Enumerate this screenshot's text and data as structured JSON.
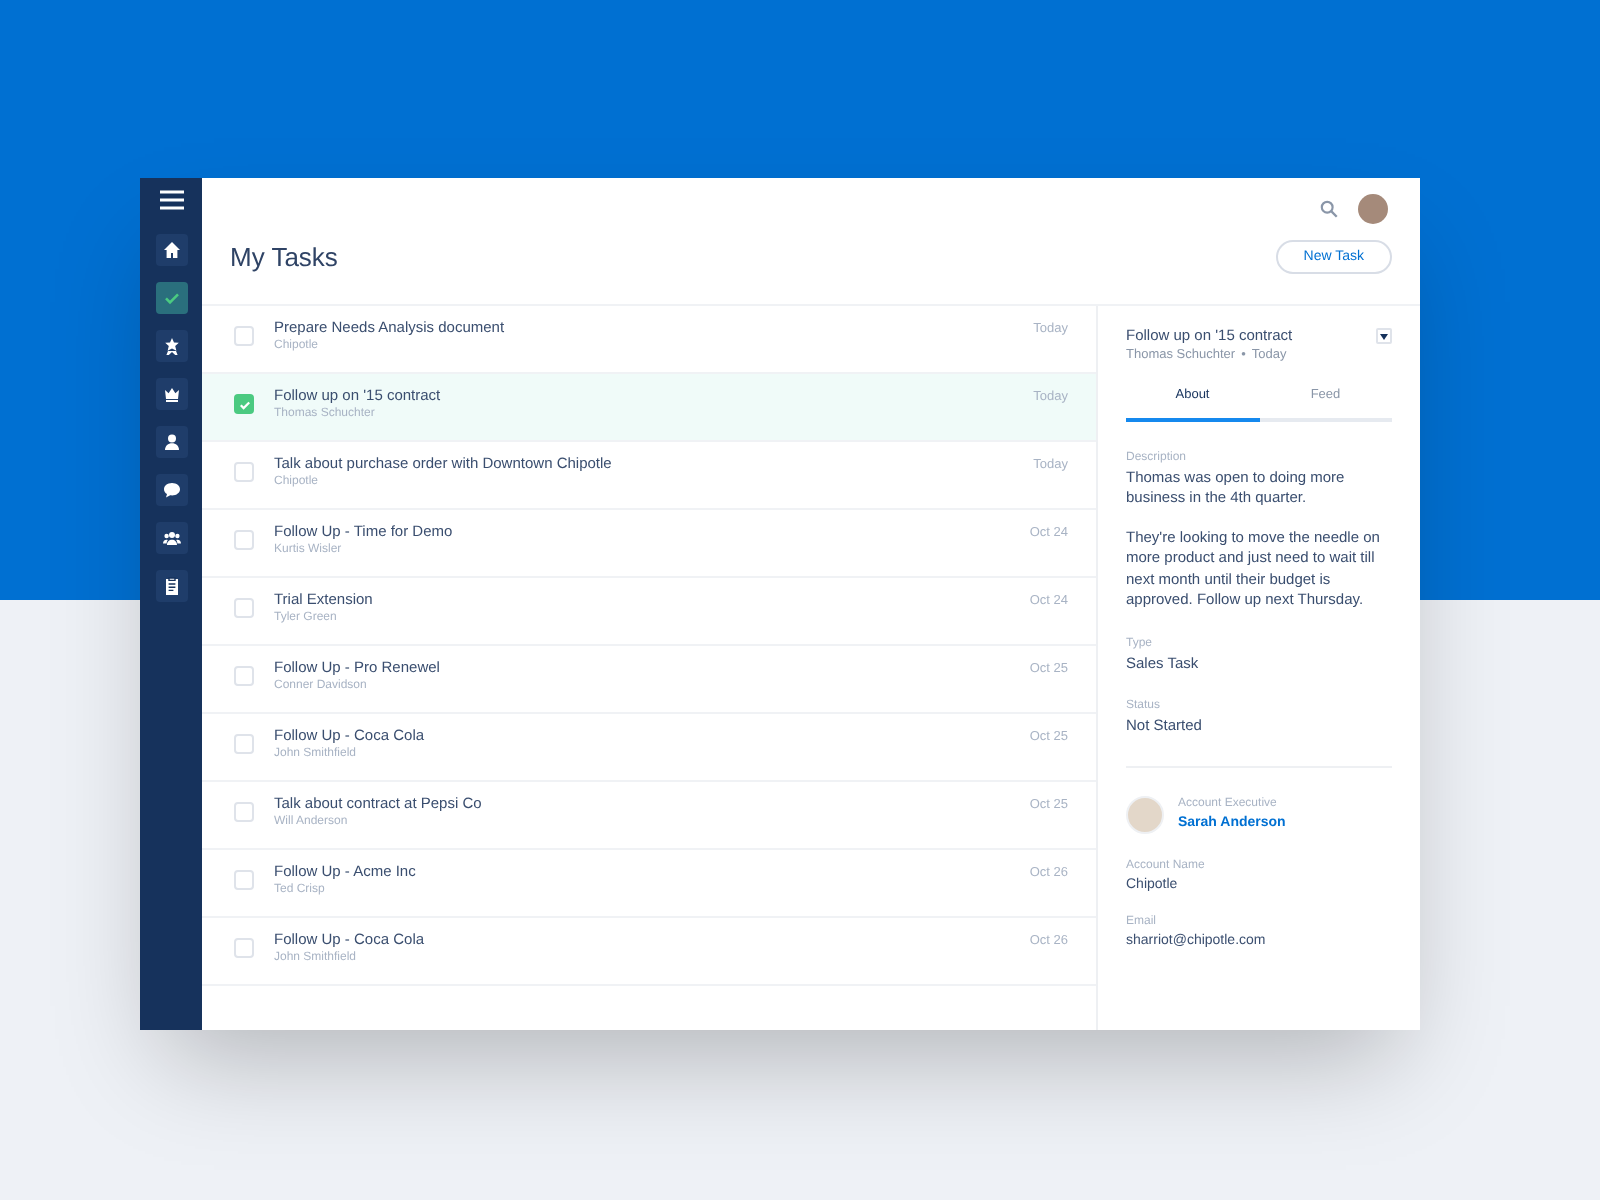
{
  "sidebar": {
    "items": [
      {
        "kind": "home",
        "selected": false
      },
      {
        "kind": "check",
        "selected": true
      },
      {
        "kind": "award",
        "selected": false
      },
      {
        "kind": "crown",
        "selected": false
      },
      {
        "kind": "person",
        "selected": false
      },
      {
        "kind": "chat",
        "selected": false
      },
      {
        "kind": "group",
        "selected": false
      },
      {
        "kind": "clipboard",
        "selected": false
      }
    ]
  },
  "header": {
    "title": "My Tasks",
    "new_button": "New Task"
  },
  "tasks": [
    {
      "title": "Prepare Needs Analysis document",
      "subtitle": "Chipotle",
      "date": "Today",
      "checked": false,
      "selected": false
    },
    {
      "title": "Follow up on '15 contract",
      "subtitle": "Thomas Schuchter",
      "date": "Today",
      "checked": true,
      "selected": true
    },
    {
      "title": "Talk about purchase order with Downtown Chipotle",
      "subtitle": "Chipotle",
      "date": "Today",
      "checked": false,
      "selected": false
    },
    {
      "title": "Follow Up - Time for Demo",
      "subtitle": "Kurtis Wisler",
      "date": "Oct 24",
      "checked": false,
      "selected": false
    },
    {
      "title": "Trial Extension",
      "subtitle": "Tyler Green",
      "date": "Oct 24",
      "checked": false,
      "selected": false
    },
    {
      "title": "Follow Up - Pro Renewel",
      "subtitle": "Conner Davidson",
      "date": "Oct 25",
      "checked": false,
      "selected": false
    },
    {
      "title": "Follow Up - Coca Cola",
      "subtitle": "John Smithfield",
      "date": "Oct 25",
      "checked": false,
      "selected": false
    },
    {
      "title": "Talk about contract at Pepsi Co",
      "subtitle": "Will Anderson",
      "date": "Oct 25",
      "checked": false,
      "selected": false
    },
    {
      "title": "Follow Up - Acme Inc",
      "subtitle": "Ted Crisp",
      "date": "Oct 26",
      "checked": false,
      "selected": false
    },
    {
      "title": "Follow Up - Coca Cola",
      "subtitle": "John Smithfield",
      "date": "Oct 26",
      "checked": false,
      "selected": false
    }
  ],
  "detail": {
    "title": "Follow up on '15 contract",
    "owner": "Thomas Schuchter",
    "separator": "•",
    "date": "Today",
    "tabs": [
      {
        "label": "About",
        "selected": true
      },
      {
        "label": "Feed",
        "selected": false
      }
    ],
    "fields": [
      {
        "label": "Description",
        "paragraphs": [
          "Thomas was open to doing more business in the 4th quarter.",
          "They're looking to move the needle on more product and just need to wait till next month until their budget is approved. Follow up next Thursday."
        ]
      },
      {
        "label": "Type",
        "paragraphs": [
          "Sales Task"
        ]
      },
      {
        "label": "Status",
        "paragraphs": [
          "Not Started"
        ]
      }
    ],
    "account_executive": {
      "label": "Account Executive",
      "name": "Sarah Anderson"
    },
    "contact_fields": [
      {
        "label": "Account Name",
        "value": "Chipotle"
      },
      {
        "label": "Email",
        "value": "sharriot@chipotle.com"
      }
    ]
  }
}
